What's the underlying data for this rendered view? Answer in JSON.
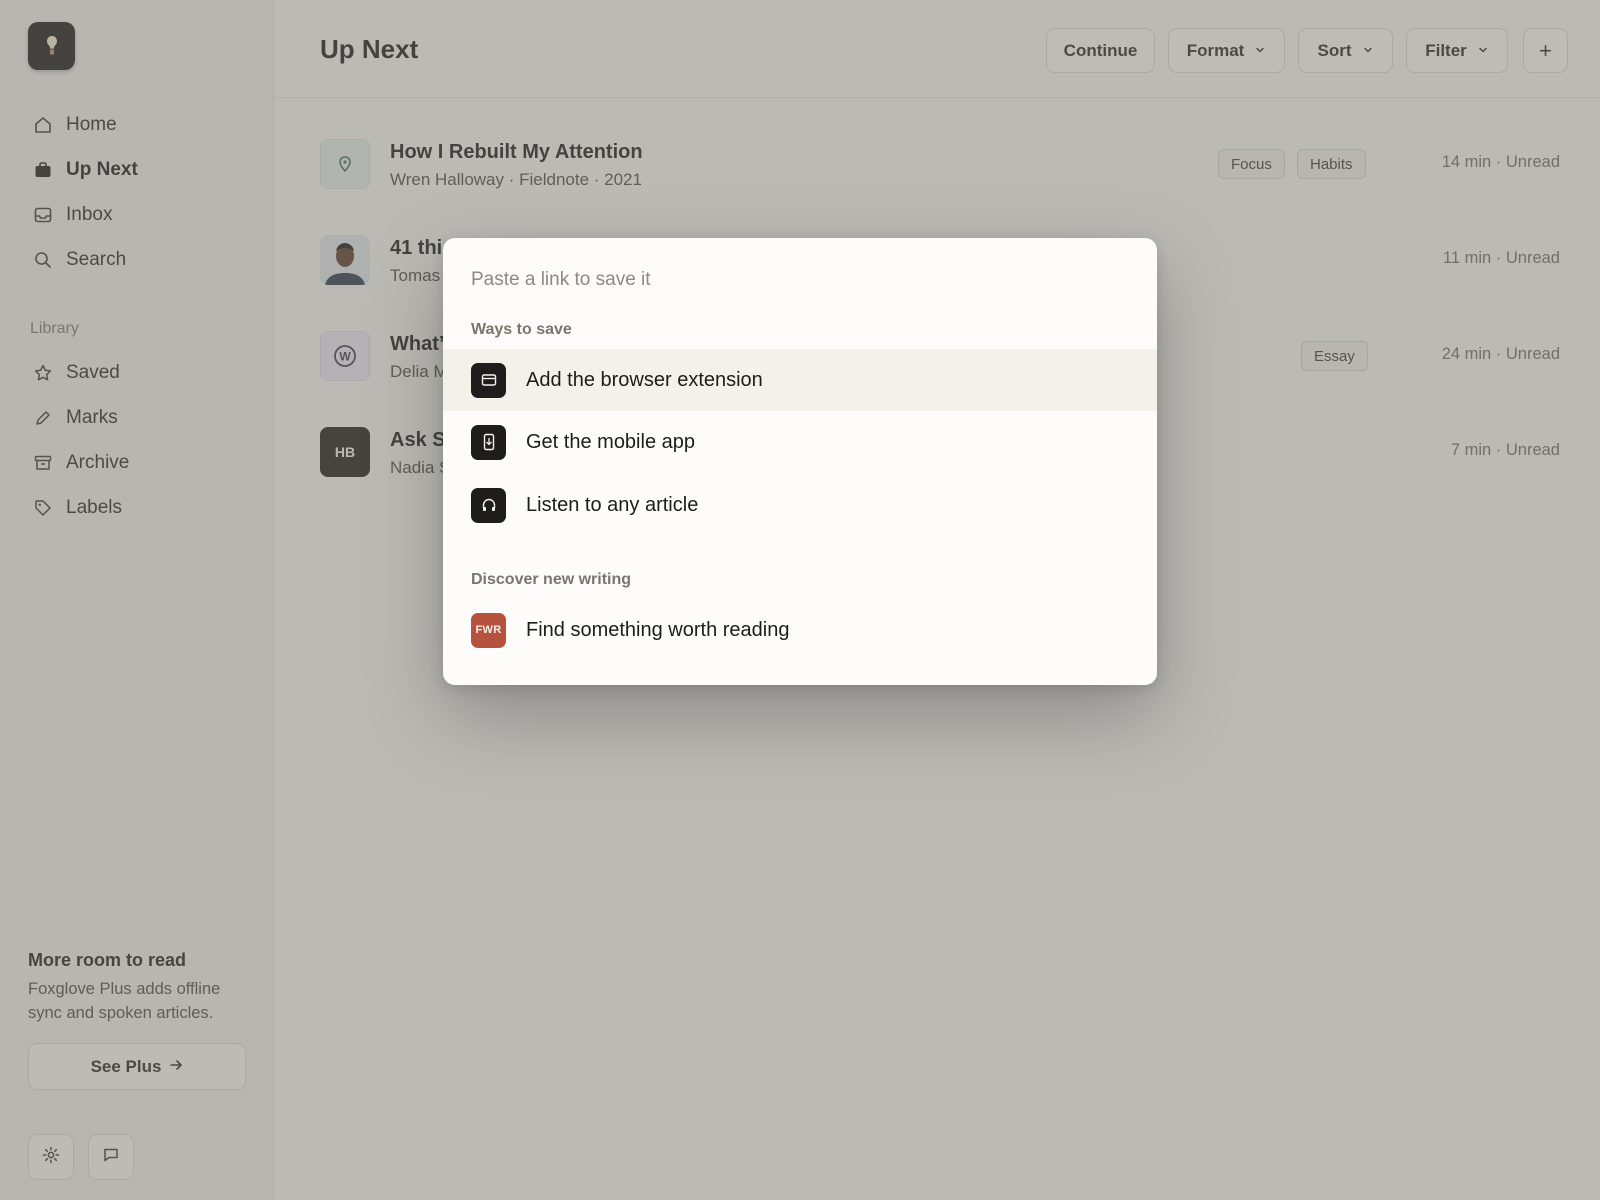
{
  "sidebar": {
    "nav": [
      {
        "label": "Home",
        "icon": "home-icon",
        "active": false
      },
      {
        "label": "Up Next",
        "icon": "bag-icon",
        "active": true
      },
      {
        "label": "Inbox",
        "icon": "inbox-icon",
        "active": false
      },
      {
        "label": "Search",
        "icon": "search-icon",
        "active": false
      }
    ],
    "library_label": "Library",
    "library": [
      {
        "label": "Saved",
        "icon": "star-icon"
      },
      {
        "label": "Marks",
        "icon": "pencil-icon"
      },
      {
        "label": "Archive",
        "icon": "archive-icon"
      },
      {
        "label": "Labels",
        "icon": "tag-icon"
      }
    ],
    "promo": {
      "title": "More room to read",
      "text": "Foxglove Plus adds offline sync and spoken articles.",
      "button": "See Plus"
    }
  },
  "header": {
    "title": "Up Next",
    "continue": "Continue",
    "format": "Format",
    "sort": "Sort",
    "filter": "Filter",
    "add": "+"
  },
  "articles": [
    {
      "title": "How I Rebuilt My Attention",
      "meta": "Wren Halloway · Fieldnote · 2021",
      "tags": [
        "Focus",
        "Habits"
      ],
      "status": "14 min · Unread"
    },
    {
      "title": "41 thi",
      "meta": "Tomas",
      "tags": [],
      "status": "11 min · Unread"
    },
    {
      "title": "What’",
      "meta": "Delia M",
      "tags": [
        "Essay"
      ],
      "status": "24 min · Unread"
    },
    {
      "title": "Ask S",
      "meta": "Nadia S",
      "tags": [],
      "status": "7 min · Unread",
      "thumb": "HB"
    }
  ],
  "modal": {
    "placeholder": "Paste a link to save it",
    "ways_label": "Ways to save",
    "ways": [
      {
        "label": "Add the browser extension",
        "icon": "browser-icon"
      },
      {
        "label": "Get the mobile app",
        "icon": "phone-icon"
      },
      {
        "label": "Listen to any article",
        "icon": "headphones-icon"
      }
    ],
    "discover_label": "Discover new writing",
    "discover": [
      {
        "label": "Find something worth reading",
        "badge": "FWR",
        "badge_color": "#b5533f"
      }
    ]
  }
}
